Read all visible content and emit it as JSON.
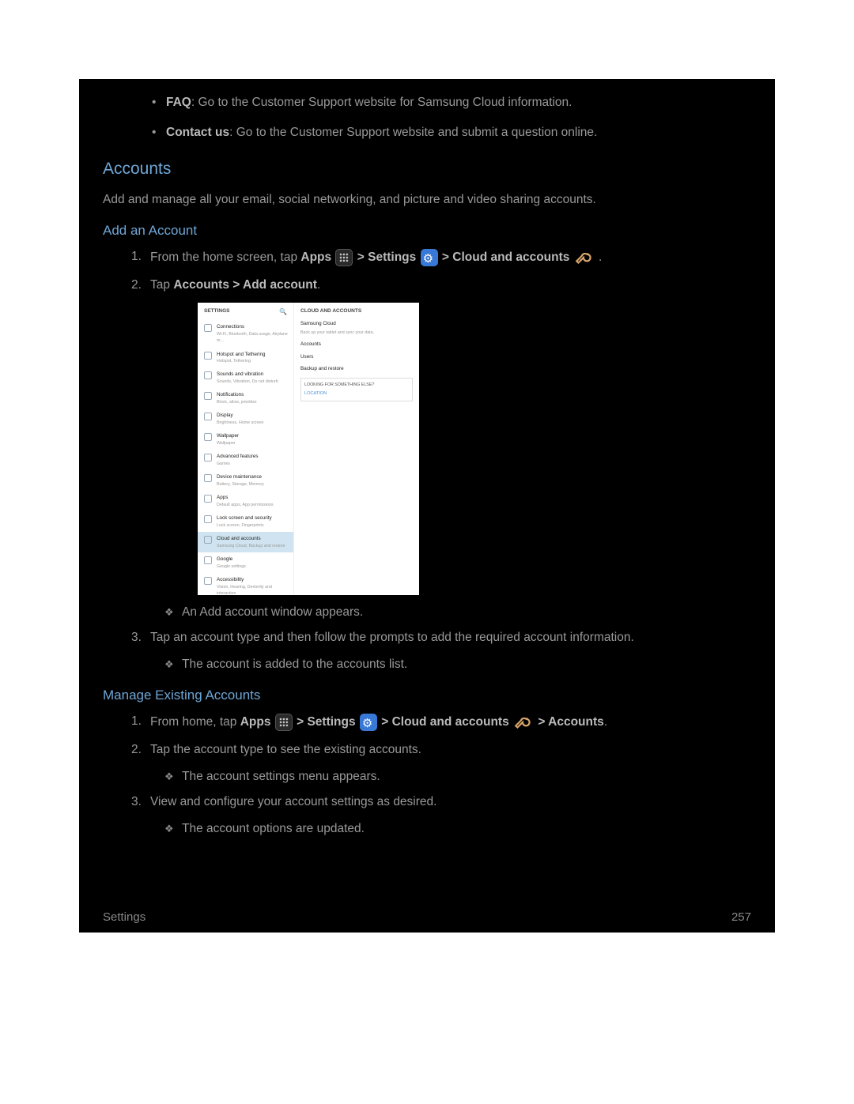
{
  "top_bullets": [
    {
      "bold": "FAQ",
      "rest": ": Go to the Customer Support website for Samsung Cloud information."
    },
    {
      "bold": "Contact us",
      "rest": ": Go to the Customer Support website and submit a question online."
    }
  ],
  "h2_accounts": "Accounts",
  "accounts_intro": "Add and manage all your email, social networking, and picture and video sharing accounts.",
  "h3_add": "Add an Account",
  "step1_pre": "From the home screen, tap ",
  "label_apps": "Apps",
  "sep_gt": " > ",
  "label_settings": "Settings",
  "label_cloud": "Cloud and accounts",
  "period": ".",
  "step2_pre": "Tap ",
  "step2_bold": "Accounts > Add account",
  "sub_add_window": "An Add account window appears.",
  "step3": "Tap an account type and then follow the prompts to add the required account information.",
  "sub_added": "The account is added to the accounts list.",
  "h3_manage": "Manage Existing Accounts",
  "m_step1_pre": "From home, tap ",
  "label_accounts_end": "Accounts",
  "m_step2": "Tap the account type to see the existing accounts.",
  "m_sub2": "The account settings menu appears.",
  "m_step3": "View and configure your account settings as desired.",
  "m_sub3": "The account options are updated.",
  "mock": {
    "left_header": "SETTINGS",
    "search_glyph": "🔍",
    "rows": [
      {
        "t": "Connections",
        "s": "Wi-Fi, Bluetooth, Data usage, Airplane m..."
      },
      {
        "t": "Hotspot and Tethering",
        "s": "Hotspot, Tethering"
      },
      {
        "t": "Sounds and vibration",
        "s": "Sounds, Vibration, Do not disturb"
      },
      {
        "t": "Notifications",
        "s": "Block, allow, prioritize"
      },
      {
        "t": "Display",
        "s": "Brightness, Home screen"
      },
      {
        "t": "Wallpaper",
        "s": "Wallpaper"
      },
      {
        "t": "Advanced features",
        "s": "Games"
      },
      {
        "t": "Device maintenance",
        "s": "Battery, Storage, Memory"
      },
      {
        "t": "Apps",
        "s": "Default apps, App permissions"
      },
      {
        "t": "Lock screen and security",
        "s": "Lock screen, Fingerprints"
      },
      {
        "t": "Cloud and accounts",
        "s": "Samsung Cloud, Backup and restore",
        "sel": true
      },
      {
        "t": "Google",
        "s": "Google settings"
      },
      {
        "t": "Accessibility",
        "s": "Vision, Hearing, Dexterity and interaction"
      }
    ],
    "right_header": "CLOUD AND ACCOUNTS",
    "r_item1": "Samsung Cloud",
    "r_sub1": "Back up your tablet and sync your data.",
    "r_item2": "Accounts",
    "r_item3": "Users",
    "r_item4": "Backup and restore",
    "look_hdr": "LOOKING FOR SOMETHING ELSE?",
    "look_link": "LOCATION"
  },
  "footer_left": "Settings",
  "footer_right": "257"
}
